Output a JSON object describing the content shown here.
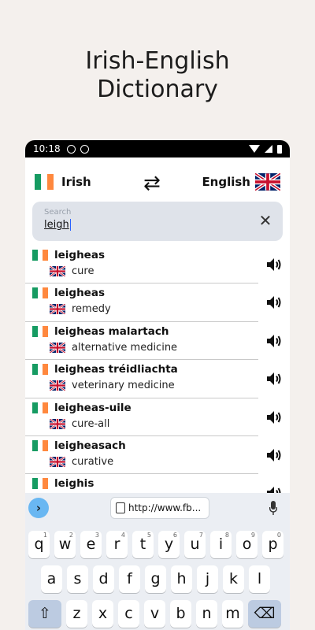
{
  "promo": {
    "title_line1": "Irish-English",
    "title_line2": "Dictionary"
  },
  "status_bar": {
    "time": "10:18"
  },
  "language_bar": {
    "source": "Irish",
    "target": "English"
  },
  "search": {
    "placeholder": "Search",
    "value": "leigh"
  },
  "results": [
    {
      "irish": "leigheas",
      "english": "cure"
    },
    {
      "irish": "leigheas",
      "english": "remedy"
    },
    {
      "irish": "leigheas malartach",
      "english": "alternative medicine"
    },
    {
      "irish": "leigheas tréidliachta",
      "english": "veterinary medicine"
    },
    {
      "irish": "leigheas-uile",
      "english": "cure-all"
    },
    {
      "irish": "leigheasach",
      "english": "curative"
    },
    {
      "irish": "leighis",
      "english": ""
    }
  ],
  "keyboard": {
    "suggestion_url": "http://www.fb...",
    "row1": [
      {
        "key": "q",
        "sup": "1"
      },
      {
        "key": "w",
        "sup": "2"
      },
      {
        "key": "e",
        "sup": "3"
      },
      {
        "key": "r",
        "sup": "4"
      },
      {
        "key": "t",
        "sup": "5"
      },
      {
        "key": "y",
        "sup": "6"
      },
      {
        "key": "u",
        "sup": "7"
      },
      {
        "key": "i",
        "sup": "8"
      },
      {
        "key": "o",
        "sup": "9"
      },
      {
        "key": "p",
        "sup": "0"
      }
    ],
    "row2": [
      "a",
      "s",
      "d",
      "f",
      "g",
      "h",
      "j",
      "k",
      "l"
    ],
    "row3": [
      "z",
      "x",
      "c",
      "v",
      "b",
      "n",
      "m"
    ]
  },
  "colors": {
    "accent_blue": "#69b7f2",
    "ireland_green": "#169b62",
    "ireland_orange": "#ff883e",
    "search_bg": "#dfe3ea"
  },
  "icons": {
    "swap": "swap-arrows-icon",
    "clear": "close-icon",
    "speaker": "speaker-icon",
    "mic": "mic-icon",
    "shift": "shift-icon",
    "backspace": "backspace-icon"
  }
}
